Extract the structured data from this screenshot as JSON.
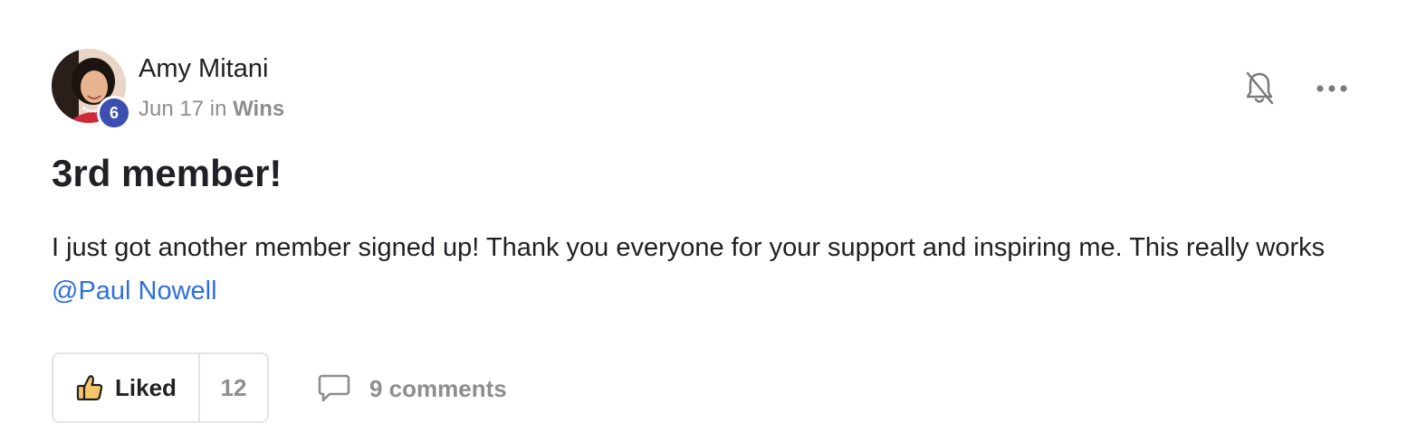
{
  "post": {
    "author": {
      "name": "Amy Mitani",
      "level": "6"
    },
    "meta": {
      "date": "Jun 17",
      "in_word": "in",
      "category": "Wins"
    },
    "title": "3rd member!",
    "body_text": "I just got another member signed up! Thank you everyone for your support and inspiring me. This really works ",
    "mention": "@Paul Nowell",
    "actions": {
      "like_label": "Liked",
      "like_count": "12",
      "comments_label": "9 comments"
    },
    "icons": {
      "bell": "bell-off-icon",
      "more": "more-horizontal-icon",
      "like": "thumbs-up-icon",
      "comments": "comment-bubble-icon"
    },
    "colors": {
      "accent_link": "#2f6fe0",
      "badge": "#3c4fb0",
      "muted": "#8e8e8e"
    }
  }
}
